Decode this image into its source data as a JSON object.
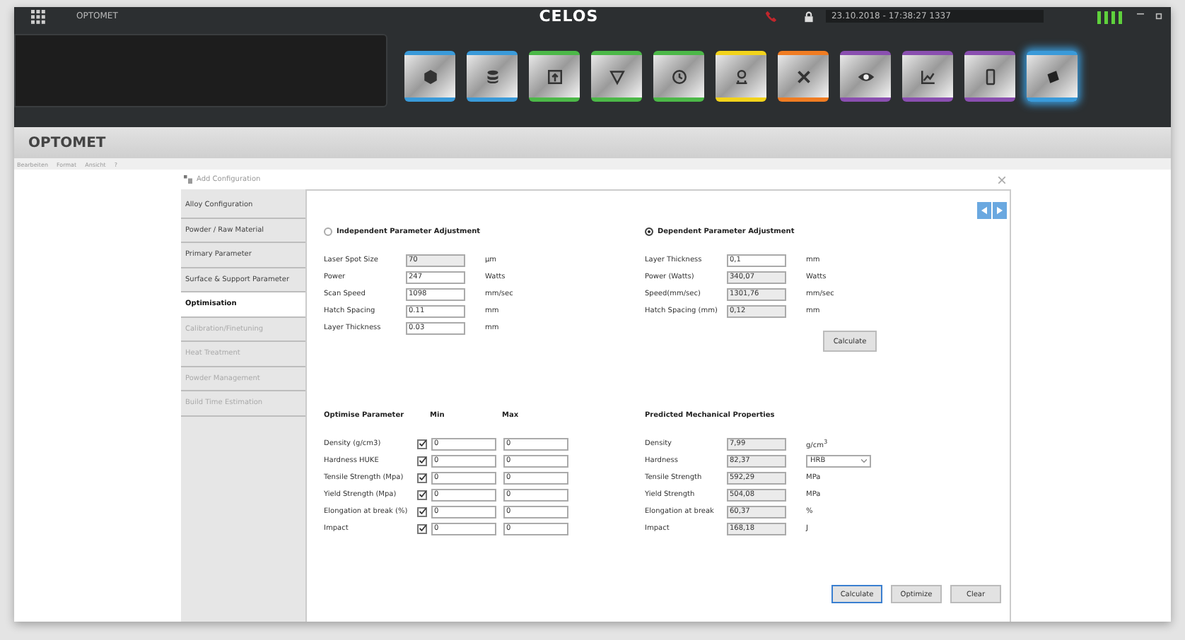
{
  "topbar": {
    "breadcrumb": "OPTOMET",
    "title": "CELOS",
    "datetime": "23.10.2018 - 17:38:27 1337"
  },
  "apps": [
    {
      "color": "#3a9ad9",
      "selected": false
    },
    {
      "color": "#3a9ad9",
      "selected": false
    },
    {
      "color": "#4cb848",
      "selected": false
    },
    {
      "color": "#4cb848",
      "selected": false
    },
    {
      "color": "#4cb848",
      "selected": false
    },
    {
      "color": "#f2d31b",
      "selected": false
    },
    {
      "color": "#f07c22",
      "selected": false
    },
    {
      "color": "#8a4fb0",
      "selected": false
    },
    {
      "color": "#8a4fb0",
      "selected": false
    },
    {
      "color": "#8a4fb0",
      "selected": false
    },
    {
      "color": "#3a9ad9",
      "selected": true
    }
  ],
  "app_title": "OPTOMET",
  "menu": [
    "Bearbeiten",
    "Format",
    "Ansicht",
    "?"
  ],
  "dialog": {
    "title": "Add Configuration",
    "sidebar": [
      {
        "label": "Alloy Configuration",
        "selected": false,
        "disabled": false
      },
      {
        "label": "Powder / Raw Material",
        "selected": false,
        "disabled": false
      },
      {
        "label": "Primary Parameter",
        "selected": false,
        "disabled": false
      },
      {
        "label": "Surface & Support Parameter",
        "selected": false,
        "disabled": false
      },
      {
        "label": "Optimisation",
        "selected": true,
        "disabled": false
      },
      {
        "label": "Calibration/Finetuning",
        "selected": false,
        "disabled": true
      },
      {
        "label": "Heat Treatment",
        "selected": false,
        "disabled": true
      },
      {
        "label": "Powder Management",
        "selected": false,
        "disabled": true
      },
      {
        "label": "Build Time Estimation",
        "selected": false,
        "disabled": true
      }
    ],
    "independent": {
      "title": "Independent Parameter Adjustment",
      "selected": false,
      "rows": [
        {
          "label": "Laser Spot Size",
          "value": "70",
          "unit": "µm",
          "readonly": true
        },
        {
          "label": "Power",
          "value": "247",
          "unit": "Watts",
          "readonly": false
        },
        {
          "label": "Scan Speed",
          "value": "1098",
          "unit": "mm/sec",
          "readonly": false
        },
        {
          "label": "Hatch Spacing",
          "value": "0.11",
          "unit": "mm",
          "readonly": false
        },
        {
          "label": "Layer Thickness",
          "value": "0.03",
          "unit": "mm",
          "readonly": false
        }
      ]
    },
    "dependent": {
      "title": "Dependent Parameter Adjustment",
      "selected": true,
      "rows": [
        {
          "label": "Layer Thickness",
          "value": "0,1",
          "unit": "mm",
          "readonly": false
        },
        {
          "label": "Power (Watts)",
          "value": "340,07",
          "unit": "Watts",
          "readonly": true
        },
        {
          "label": "Speed(mm/sec)",
          "value": "1301,76",
          "unit": "mm/sec",
          "readonly": true
        },
        {
          "label": "Hatch Spacing (mm)",
          "value": "0,12",
          "unit": "mm",
          "readonly": true
        }
      ],
      "button": "Calculate"
    },
    "optimise": {
      "title": "Optimise Parameter",
      "min_header": "Min",
      "max_header": "Max",
      "rows": [
        {
          "label": "Density (g/cm3)",
          "checked": true,
          "min": "0",
          "max": "0"
        },
        {
          "label": "Hardness   HUKE",
          "checked": true,
          "min": "0",
          "max": "0"
        },
        {
          "label": "Tensile Strength (Mpa)",
          "checked": true,
          "min": "0",
          "max": "0"
        },
        {
          "label": "Yield Strength (Mpa)",
          "checked": true,
          "min": "0",
          "max": "0"
        },
        {
          "label": "Elongation at break (%)",
          "checked": true,
          "min": "0",
          "max": "0"
        },
        {
          "label": "Impact",
          "checked": true,
          "min": "0",
          "max": "0"
        }
      ]
    },
    "predicted": {
      "title": "Predicted Mechanical Properties",
      "rows": [
        {
          "label": "Density",
          "value": "7,99",
          "unit": "g/cm$^{3}$"
        },
        {
          "label": "Hardness",
          "value": "82,37",
          "select": "HRB"
        },
        {
          "label": "Tensile Strength",
          "value": "592,29",
          "unit": "MPa"
        },
        {
          "label": "Yield Strength",
          "value": "504,08",
          "unit": "MPa"
        },
        {
          "label": "Elongation at break",
          "value": "60,37",
          "unit": "%"
        },
        {
          "label": "Impact",
          "value": "168,18",
          "unit": "J"
        }
      ]
    },
    "buttons": [
      {
        "label": "Calculate",
        "focused": true
      },
      {
        "label": "Optimize",
        "focused": false
      },
      {
        "label": "Clear",
        "focused": false
      }
    ]
  }
}
